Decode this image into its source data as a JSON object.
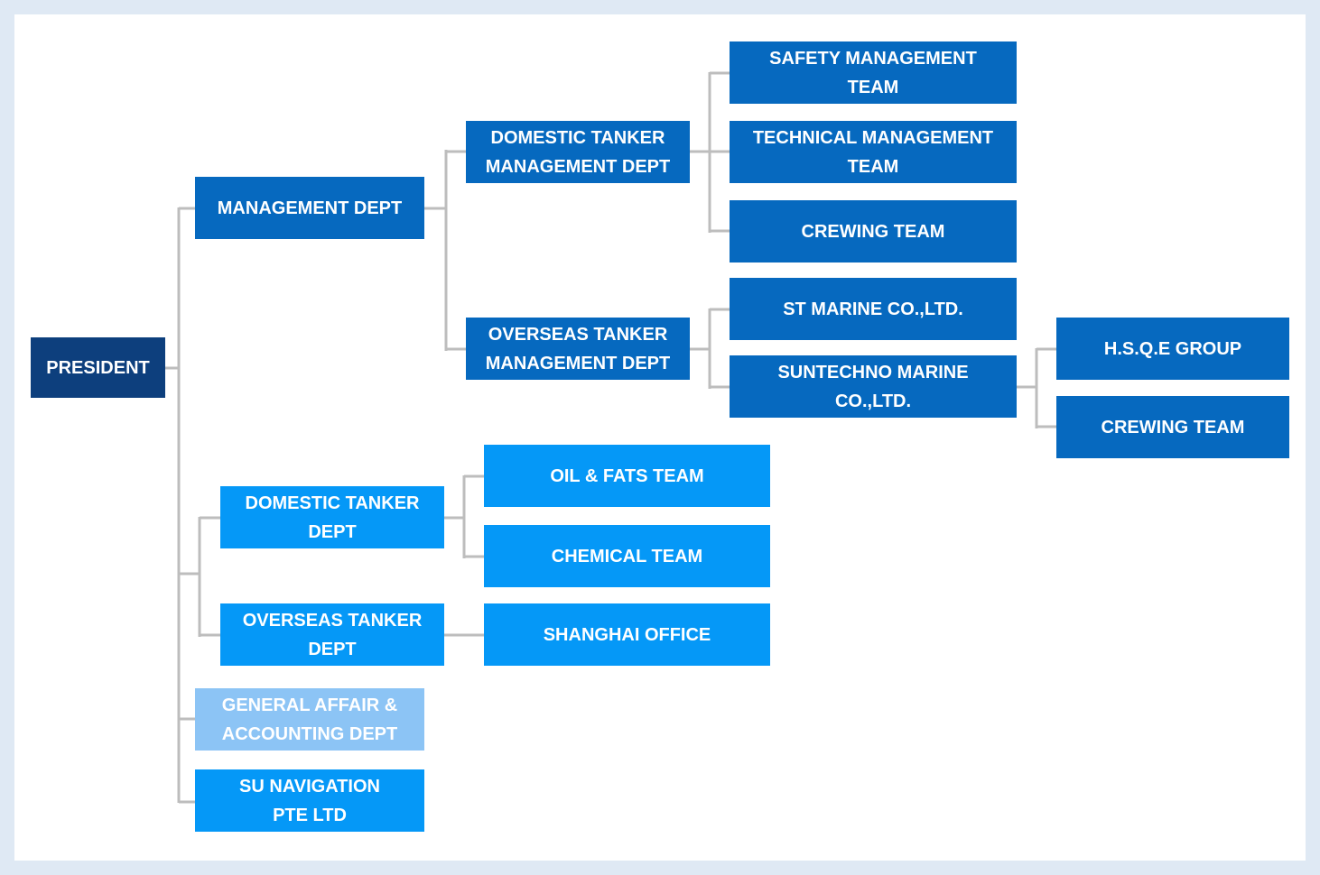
{
  "colors": {
    "president": "#0d3f7d",
    "management_branch": "#0669bf",
    "tanker_branch": "#0598f7",
    "general_affair": "#8cc4f5",
    "connector": "#bdbdbd",
    "background": "#dfe9f4"
  },
  "org": {
    "president": "PRESIDENT",
    "management_dept": "MANAGEMENT DEPT",
    "domestic_tanker_management_dept": "DOMESTIC TANKER\nMANAGEMENT DEPT",
    "overseas_tanker_management_dept": "OVERSEAS TANKER\nMANAGEMENT DEPT",
    "safety_management_team": "SAFETY MANAGEMENT\nTEAM",
    "technical_management_team": "TECHNICAL MANAGEMENT\nTEAM",
    "crewing_team": "CREWING TEAM",
    "st_marine": "ST MARINE CO.,LTD.",
    "suntechno_marine": "SUNTECHNO MARINE\nCO.,LTD.",
    "hsqe_group": "H.S.Q.E GROUP",
    "suntechno_crewing_team": "CREWING TEAM",
    "domestic_tanker_dept": "DOMESTIC TANKER\nDEPT",
    "overseas_tanker_dept": "OVERSEAS TANKER\nDEPT",
    "oil_fats_team": "OIL & FATS TEAM",
    "chemical_team": "CHEMICAL TEAM",
    "shanghai_office": "SHANGHAI OFFICE",
    "general_affair_accounting_dept": "GENERAL AFFAIR &\nACCOUNTING DEPT",
    "su_navigation": "SU NAVIGATION\nPTE LTD"
  }
}
